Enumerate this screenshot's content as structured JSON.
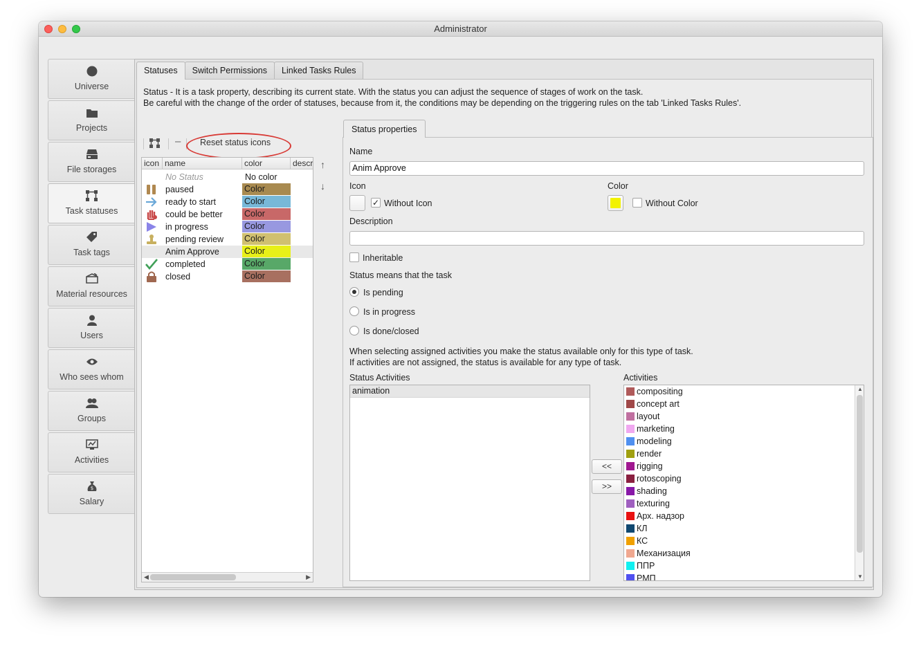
{
  "window": {
    "title": "Administrator"
  },
  "sidebar": {
    "items": [
      {
        "label": "Universe",
        "icon": "globe-icon"
      },
      {
        "label": "Projects",
        "icon": "folder-icon"
      },
      {
        "label": "File storages",
        "icon": "storage-icon"
      },
      {
        "label": "Task statuses",
        "icon": "status-flow-icon",
        "active": true
      },
      {
        "label": "Task tags",
        "icon": "tag-icon"
      },
      {
        "label": "Material resources",
        "icon": "box-icon"
      },
      {
        "label": "Users",
        "icon": "user-icon"
      },
      {
        "label": "Who sees whom",
        "icon": "eye-icon"
      },
      {
        "label": "Groups",
        "icon": "group-icon"
      },
      {
        "label": "Activities",
        "icon": "activities-icon"
      },
      {
        "label": "Salary",
        "icon": "money-bag-icon"
      }
    ]
  },
  "tabs": [
    "Statuses",
    "Switch Permissions",
    "Linked Tasks Rules"
  ],
  "intro": {
    "line1": "Status - It is a task property, describing its current state. With the status you can adjust the sequence of stages of work on the task.",
    "line2": "Be careful with the change of the order of statuses, because from it, the conditions may be depending on the triggering rules on the tab 'Linked Tasks Rules'."
  },
  "toolbar": {
    "reset_label": "Reset status icons",
    "remove_label": "–"
  },
  "status_table": {
    "headers": [
      "icon",
      "name",
      "color",
      "descri"
    ],
    "rows": [
      {
        "name": "No Status",
        "color_label": "No color",
        "color": "",
        "icon": "none"
      },
      {
        "name": "paused",
        "color_label": "Color",
        "color": "#a88a50",
        "icon": "pause-icon"
      },
      {
        "name": "ready to start",
        "color_label": "Color",
        "color": "#78b8d8",
        "icon": "arrow-right-icon"
      },
      {
        "name": "could be better",
        "color_label": "Color",
        "color": "#c86868",
        "icon": "hand-stop-icon"
      },
      {
        "name": "in progress",
        "color_label": "Color",
        "color": "#9898e0",
        "icon": "play-icon"
      },
      {
        "name": "pending review",
        "color_label": "Color",
        "color": "#d0c070",
        "icon": "stamp-icon"
      },
      {
        "name": "Anim Approve",
        "color_label": "Color",
        "color": "#e8f018",
        "icon": "none",
        "selected": true
      },
      {
        "name": "completed",
        "color_label": "Color",
        "color": "#58a868",
        "icon": "check-icon"
      },
      {
        "name": "closed",
        "color_label": "Color",
        "color": "#a87060",
        "icon": "lock-icon"
      }
    ]
  },
  "properties": {
    "tab": "Status properties",
    "name_label": "Name",
    "name_value": "Anim Approve",
    "icon_label": "Icon",
    "without_icon": "Without Icon",
    "without_icon_checked": true,
    "color_label": "Color",
    "color_value": "#f2f200",
    "without_color": "Without Color",
    "without_color_checked": false,
    "description_label": "Description",
    "description_value": "",
    "inheritable": "Inheritable",
    "status_means": "Status means that the task",
    "radios": [
      {
        "label": "Is pending",
        "checked": true
      },
      {
        "label": "Is in progress",
        "checked": false
      },
      {
        "label": "Is done/closed",
        "checked": false
      }
    ],
    "activities_note1": "When selecting assigned activities you make the status available only for this type of task.",
    "activities_note2": "If activities are not assigned, the status is available for any type of task.",
    "status_activities_label": "Status Activities",
    "status_activities": [
      "animation"
    ],
    "activities_label": "Activities",
    "move_left": "<<",
    "move_right": ">>",
    "activities": [
      {
        "name": "compositing",
        "color": "#b05a5a"
      },
      {
        "name": "concept art",
        "color": "#a04848"
      },
      {
        "name": "layout",
        "color": "#c070a0"
      },
      {
        "name": "marketing",
        "color": "#f0a8f0"
      },
      {
        "name": "modeling",
        "color": "#5090f0"
      },
      {
        "name": "render",
        "color": "#a0a010"
      },
      {
        "name": "rigging",
        "color": "#a01890"
      },
      {
        "name": "rotoscoping",
        "color": "#8a2040"
      },
      {
        "name": "shading",
        "color": "#8818a8"
      },
      {
        "name": "texturing",
        "color": "#a060c0"
      },
      {
        "name": "Арх. надзор",
        "color": "#e81010"
      },
      {
        "name": "КЛ",
        "color": "#104870"
      },
      {
        "name": "КС",
        "color": "#f0a000"
      },
      {
        "name": "Механизация",
        "color": "#f0a890"
      },
      {
        "name": "ППР",
        "color": "#10f0f0"
      },
      {
        "name": "РМП",
        "color": "#5050f0"
      }
    ]
  }
}
